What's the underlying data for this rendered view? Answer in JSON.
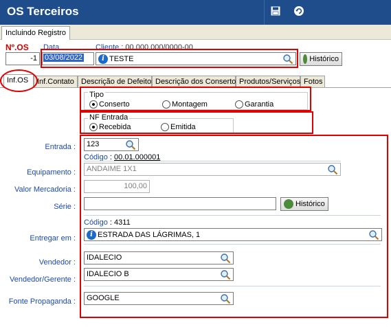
{
  "window": {
    "title": "OS Terceiros"
  },
  "mode_tab": "Incluindo Registro",
  "header": {
    "os_label": "Nº.OS",
    "os_value": "-1",
    "data_label": "Data",
    "data_value": "03/08/2022",
    "cliente_label": "Cliente",
    "cliente_code": " : 00.000.000/0000-00",
    "cliente_value": "TESTE",
    "historico_label": "Histórico"
  },
  "tabs": [
    {
      "label": "Inf.OS",
      "active": true
    },
    {
      "label": "Inf.Contato"
    },
    {
      "label": "Descrição de Defeitos"
    },
    {
      "label": "Descrição dos Consertos"
    },
    {
      "label": "Produtos/Serviços"
    },
    {
      "label": "Fotos"
    }
  ],
  "tipo": {
    "title": "Tipo",
    "options": [
      "Conserto",
      "Montagem",
      "Garantia"
    ],
    "selected": "Conserto"
  },
  "nf_entrada": {
    "title": "NF Entrada",
    "options": [
      "Recebida",
      "Emitida"
    ],
    "selected": "Recebida"
  },
  "form": {
    "entrada_label": "Entrada :",
    "entrada_value": "123",
    "codigo_label": "Código",
    "codigo_value": "00.01.000001",
    "equipamento_label": "Equipamento :",
    "equipamento_value": "ANDAIME 1X1",
    "valor_label": "Valor Mercadoria :",
    "valor_value": "100,00",
    "serie_label": "Série :",
    "serie_value": "",
    "serie_historico": "Histórico",
    "entregar_codigo_label": "Código",
    "entregar_codigo_value": " : 4311",
    "entregar_label": "Entregar em :",
    "entregar_value": "ESTRADA DAS LÁGRIMAS, 1",
    "vendedor_label": "Vendedor :",
    "vendedor_value": "IDALECIO",
    "vendedor_gerente_label": "Vendedor/Gerente :",
    "vendedor_gerente_value": "IDALECIO B",
    "fonte_label": "Fonte Propaganda :",
    "fonte_value": "GOOGLE"
  }
}
